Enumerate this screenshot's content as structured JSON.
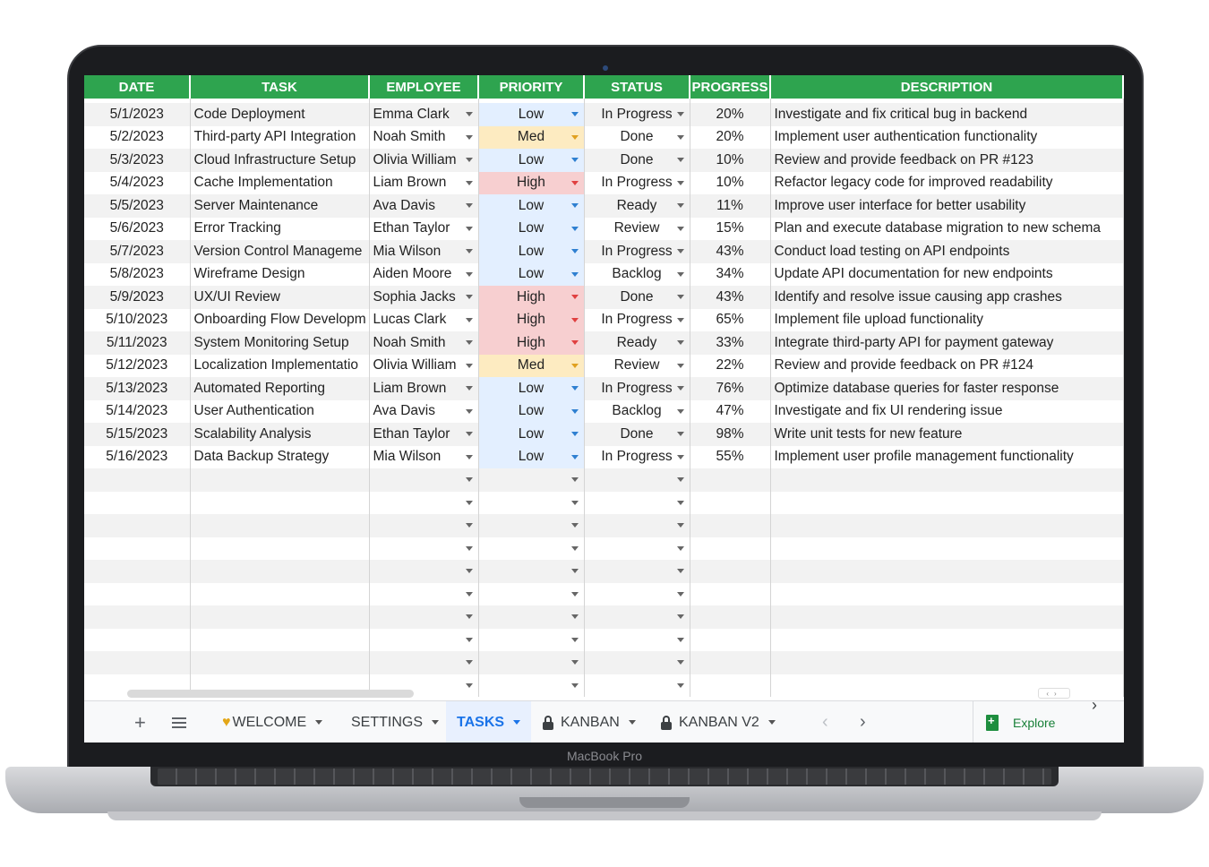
{
  "device_label": "MacBook Pro",
  "columns": [
    "DATE",
    "TASK",
    "EMPLOYEE",
    "PRIORITY",
    "STATUS",
    "PROGRESS",
    "DESCRIPTION"
  ],
  "rows": [
    {
      "date": "5/1/2023",
      "task": "Code Deployment",
      "employee": "Emma Clark",
      "priority": "Low",
      "status": "In Progress",
      "progress": "20%",
      "description": "Investigate and fix critical bug in backend"
    },
    {
      "date": "5/2/2023",
      "task": "Third-party API Integration",
      "employee": "Noah Smith",
      "priority": "Med",
      "status": "Done",
      "progress": "20%",
      "description": "Implement user authentication functionality"
    },
    {
      "date": "5/3/2023",
      "task": "Cloud Infrastructure Setup",
      "employee": "Olivia William",
      "priority": "Low",
      "status": "Done",
      "progress": "10%",
      "description": "Review and provide feedback on PR #123"
    },
    {
      "date": "5/4/2023",
      "task": "Cache Implementation",
      "employee": "Liam Brown",
      "priority": "High",
      "status": "In Progress",
      "progress": "10%",
      "description": "Refactor legacy code for improved readability"
    },
    {
      "date": "5/5/2023",
      "task": "Server Maintenance",
      "employee": "Ava Davis",
      "priority": "Low",
      "status": "Ready",
      "progress": "11%",
      "description": "Improve user interface for better usability"
    },
    {
      "date": "5/6/2023",
      "task": "Error Tracking",
      "employee": "Ethan Taylor",
      "priority": "Low",
      "status": "Review",
      "progress": "15%",
      "description": "Plan and execute database migration to new schema"
    },
    {
      "date": "5/7/2023",
      "task": "Version Control Manageme",
      "employee": "Mia Wilson",
      "priority": "Low",
      "status": "In Progress",
      "progress": "43%",
      "description": "Conduct load testing on API endpoints"
    },
    {
      "date": "5/8/2023",
      "task": "Wireframe Design",
      "employee": "Aiden Moore",
      "priority": "Low",
      "status": "Backlog",
      "progress": "34%",
      "description": "Update API documentation for new endpoints"
    },
    {
      "date": "5/9/2023",
      "task": "UX/UI Review",
      "employee": "Sophia Jacks",
      "priority": "High",
      "status": "Done",
      "progress": "43%",
      "description": "Identify and resolve issue causing app crashes"
    },
    {
      "date": "5/10/2023",
      "task": "Onboarding Flow Developm",
      "employee": "Lucas Clark",
      "priority": "High",
      "status": "In Progress",
      "progress": "65%",
      "description": "Implement file upload functionality"
    },
    {
      "date": "5/11/2023",
      "task": "System Monitoring Setup",
      "employee": "Noah Smith",
      "priority": "High",
      "status": "Ready",
      "progress": "33%",
      "description": "Integrate third-party API for payment gateway"
    },
    {
      "date": "5/12/2023",
      "task": "Localization Implementatio",
      "employee": "Olivia William",
      "priority": "Med",
      "status": "Review",
      "progress": "22%",
      "description": "Review and provide feedback on PR #124"
    },
    {
      "date": "5/13/2023",
      "task": "Automated Reporting",
      "employee": "Liam Brown",
      "priority": "Low",
      "status": "In Progress",
      "progress": "76%",
      "description": "Optimize database queries for faster response"
    },
    {
      "date": "5/14/2023",
      "task": "User Authentication",
      "employee": "Ava Davis",
      "priority": "Low",
      "status": "Backlog",
      "progress": "47%",
      "description": "Investigate and fix UI rendering issue"
    },
    {
      "date": "5/15/2023",
      "task": "Scalability Analysis",
      "employee": "Ethan Taylor",
      "priority": "Low",
      "status": "Done",
      "progress": "98%",
      "description": "Write unit tests for new feature"
    },
    {
      "date": "5/16/2023",
      "task": "Data Backup Strategy",
      "employee": "Mia Wilson",
      "priority": "Low",
      "status": "In Progress",
      "progress": "55%",
      "description": "Implement user profile management functionality"
    }
  ],
  "empty_rows": 10,
  "tabs": {
    "add_icon": "plus-icon",
    "menu_icon": "menu-icon",
    "welcome": "WELCOME",
    "settings": "SETTINGS",
    "tasks": "TASKS",
    "kanban": "KANBAN",
    "kanban_v2": "KANBAN V2",
    "explore": "Explore"
  },
  "colors": {
    "header": "#2ea44f",
    "low": "#e3efff",
    "med": "#fdebc1",
    "high": "#f7cfd0",
    "active_tab": "#1a73e8"
  }
}
